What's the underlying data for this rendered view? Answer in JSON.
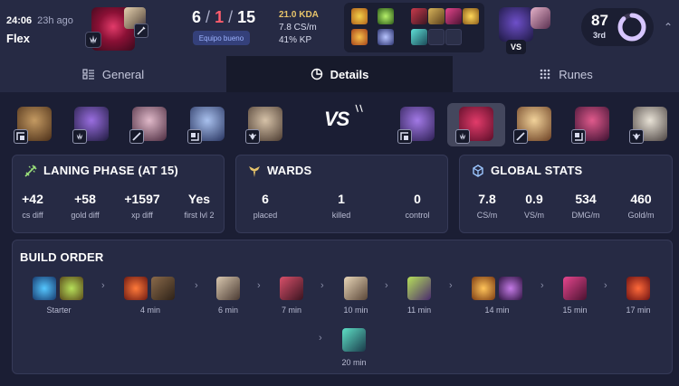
{
  "header": {
    "time": "24:06",
    "ago": "23h ago",
    "queue": "Flex",
    "kda_kills": "6",
    "kda_slash1": "/",
    "kda_deaths": "1",
    "kda_slash2": "/",
    "kda_assists": "15",
    "team_badge": "Equipo bueno",
    "kda_ratio": "21.0 KDA",
    "cs_per_min": "7.8 CS/m",
    "kill_participation": "41% KP",
    "vs_label": "VS",
    "score": "87",
    "rank": "3rd",
    "score_fraction": 0.87,
    "colors": {
      "deaths": "#ff5d6d",
      "kda": "#e6c36a",
      "ring": "#d7c6ff"
    }
  },
  "tabs": [
    {
      "label": "General",
      "icon": "list-icon"
    },
    {
      "label": "Details",
      "icon": "pie-chart-icon"
    },
    {
      "label": "Runes",
      "icon": "grid-dots-icon"
    }
  ],
  "matchup": {
    "vs_label": "VS"
  },
  "laning": {
    "title": "LANING PHASE (AT 15)",
    "stats": [
      {
        "value": "+42",
        "label": "cs diff"
      },
      {
        "value": "+58",
        "label": "gold diff"
      },
      {
        "value": "+1597",
        "label": "xp diff"
      },
      {
        "value": "Yes",
        "label": "first lvl 2"
      }
    ]
  },
  "wards": {
    "title": "WARDS",
    "stats": [
      {
        "value": "6",
        "label": "placed"
      },
      {
        "value": "1",
        "label": "killed"
      },
      {
        "value": "0",
        "label": "control"
      }
    ]
  },
  "global": {
    "title": "GLOBAL STATS",
    "stats": [
      {
        "value": "7.8",
        "label": "CS/m"
      },
      {
        "value": "0.9",
        "label": "VS/m"
      },
      {
        "value": "534",
        "label": "DMG/m"
      },
      {
        "value": "460",
        "label": "Gold/m"
      }
    ]
  },
  "build": {
    "title": "BUILD ORDER",
    "steps": [
      {
        "label": "Starter"
      },
      {
        "label": "4 min"
      },
      {
        "label": "6 min"
      },
      {
        "label": "7 min"
      },
      {
        "label": "10 min"
      },
      {
        "label": "11 min"
      },
      {
        "label": "14 min"
      },
      {
        "label": "15 min"
      },
      {
        "label": "17 min"
      },
      {
        "label": "20 min"
      }
    ]
  }
}
